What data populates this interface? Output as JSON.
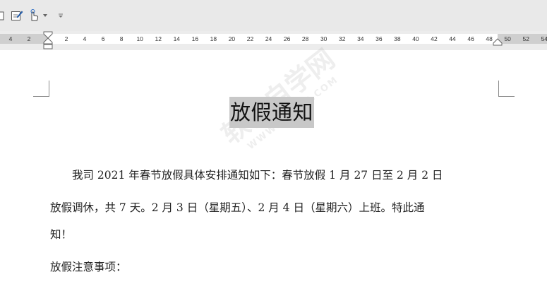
{
  "toolbar": {
    "items": [
      {
        "icon": "document-icon"
      },
      {
        "icon": "edit-icon"
      },
      {
        "icon": "touch-mode-icon"
      },
      {
        "icon": "dropdown-arrow-icon"
      },
      {
        "icon": "customize-toolbar-icon"
      }
    ]
  },
  "ruler": {
    "ticks": [
      "4",
      "2",
      "2",
      "4",
      "6",
      "8",
      "10",
      "12",
      "14",
      "16",
      "18",
      "20",
      "22",
      "24",
      "26",
      "28",
      "30",
      "32",
      "34",
      "36",
      "38",
      "40",
      "42",
      "44",
      "46",
      "48",
      "50",
      "52",
      "54"
    ]
  },
  "document": {
    "title": "放假通知",
    "paragraph1_line1": "　　我司 2021 年春节放假具体安排通知如下：春节放假 1 月 27 日至 2 月 2 日",
    "paragraph1_line2": "放假调休，共 7 天。2 月 3 日（星期五）、2 月 4 日（星期六）上班。特此通",
    "paragraph1_line3": "知！",
    "paragraph2": "放假注意事项：",
    "watermark": "软件自学网",
    "watermark_sub": "WWW.RJZXW.COM"
  }
}
